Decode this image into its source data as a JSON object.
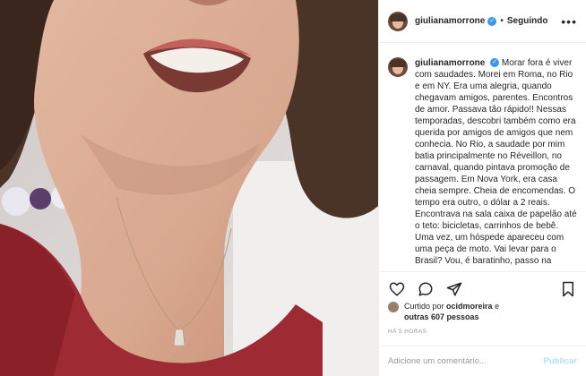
{
  "post": {
    "username": "giulianamorrone",
    "following_label": "Seguindo",
    "more_label": "•••",
    "caption": "Morar fora é viver com saudades. Morei em Roma, no Rio e em NY. Era uma alegria, quando chegavam amigos, parentes. Encontros de amor. Passava tão rápido!! Nessas temporadas, descobri também como era querida por amigos de amigos que nem conhecia. No Rio, a saudade por mim batia principalmente no Réveillon, no carnaval, quando pintava promoção de passagem. Em Nova York, era casa cheia sempre. Cheia de encomendas. O tempo era outro, o dólar a 2 reais. Encontrava na sala caixa de papelão até o teto: bicicletas, carrinhos de bebê. Uma vez, um hóspede apareceu com uma peça de moto. Vai levar para o Brasil? Vou, é baratinho, passo na",
    "likes": {
      "prefix": "Curtido por",
      "user": "ocidmoreira",
      "joiner": "e",
      "others": "outras 607 pessoas"
    },
    "time_ago": "HÁ 5 HORAS",
    "comment": {
      "placeholder": "Adicione um comentário...",
      "publish_label": "Publicar"
    }
  },
  "icons": {
    "verified": "verified-badge-icon",
    "like": "heart-icon",
    "comment": "comment-icon",
    "share": "share-icon",
    "save": "bookmark-icon"
  },
  "colors": {
    "verified": "#3897f0",
    "publish_disabled": "#b2dffc",
    "muted": "#999999"
  }
}
